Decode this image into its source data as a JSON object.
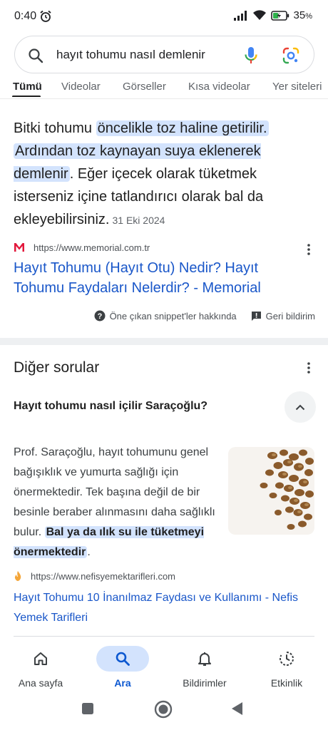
{
  "status_bar": {
    "time": "0:40",
    "battery": "35",
    "battery_unit": "%",
    "icons": [
      "alarm-icon",
      "signal-icon",
      "wifi-icon",
      "battery-charging-icon"
    ]
  },
  "search": {
    "query": "hayıt tohumu nasıl demlenir",
    "icons": [
      "search-icon",
      "mic-icon",
      "google-lens-icon"
    ]
  },
  "tabs": [
    {
      "label": "Tümü",
      "active": true
    },
    {
      "label": "Videolar"
    },
    {
      "label": "Görseller"
    },
    {
      "label": "Kısa videolar"
    },
    {
      "label": "Yer siteleri"
    }
  ],
  "featured_snippet": {
    "text_1": "Bitki tohumu ",
    "highlight_1": "öncelikle toz haline getirilir.",
    "highlight_2": "Ardından toz kaynayan suya eklenerek demlenir",
    "text_2": ". Eğer içecek olarak tüketmek isterseniz içine tatlandırıcı olarak bal da ekleyebilirsiniz.",
    "date": "31 Eki 2024",
    "source_url": "https://www.memorial.com.tr",
    "result_title": "Hayıt Tohumu (Hayıt Otu) Nedir? Hayıt Tohumu Faydaları Nelerdir? - Memorial",
    "footer_about": "Öne çıkan snippet'ler hakkında",
    "footer_feedback": "Geri bildirim"
  },
  "people_also_ask": {
    "title": "Diğer sorular",
    "question": "Hayıt tohumu nasıl içilir Saraçoğlu?",
    "answer_text": "Prof. Saraçoğlu, hayıt tohumunu genel bağışıklık ve yumurta sağlığı için önermektedir. Tek başına değil de bir besinle beraber alınmasını daha sağlıklı bulur. ",
    "answer_highlight": "Bal ya da ılık su ile tüketmeyi önermektedir",
    "answer_end": ".",
    "source_url": "https://www.nefisyemektarifleri.com",
    "result_title": "Hayıt Tohumu 10 İnanılmaz Faydası ve Kullanımı - Nefis Yemek Tarifleri"
  },
  "bottom_nav": [
    {
      "label": "Ana sayfa",
      "icon": "home-icon"
    },
    {
      "label": "Ara",
      "icon": "search-icon",
      "active": true
    },
    {
      "label": "Bildirimler",
      "icon": "bell-icon"
    },
    {
      "label": "Etkinlik",
      "icon": "activity-icon"
    }
  ],
  "colors": {
    "link": "#1a57c9",
    "highlight": "#d3e3fd",
    "active_nav": "#0b57d0"
  }
}
